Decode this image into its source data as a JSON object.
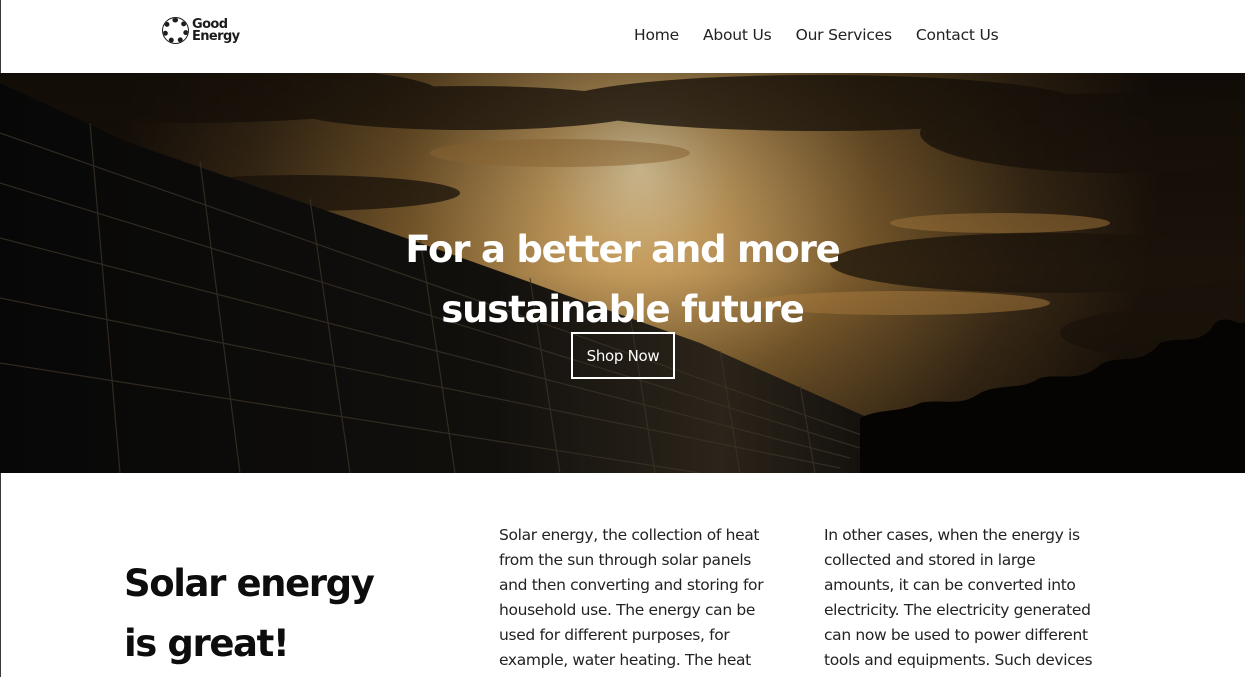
{
  "brand": {
    "logo_line1": "Good",
    "logo_line2": "Energy"
  },
  "nav": {
    "items": [
      {
        "label": "Home"
      },
      {
        "label": "About Us"
      },
      {
        "label": "Our Services"
      },
      {
        "label": "Contact Us"
      }
    ]
  },
  "hero": {
    "title_line1": "For a better and more",
    "title_line2": "sustainable future",
    "cta_label": "Shop Now"
  },
  "intro": {
    "headline_line1": "Solar energy",
    "headline_line2": "is great!",
    "column1_lines": [
      "Solar energy, the collection of heat",
      "from the sun through solar panels",
      "and then converting and storing for",
      "household use. The energy can be",
      "used for different purposes, for",
      "example, water heating. The heat"
    ],
    "column2_lines": [
      "In other cases, when the energy is",
      "collected and stored in large",
      "amounts, it can be converted into",
      "electricity. The electricity generated",
      "can now be used to power different",
      "tools and equipments. Such devices"
    ]
  },
  "colors": {
    "hero_sky_light": "#c9a060",
    "hero_sky_dark": "#2a1e10",
    "hero_panels": "#0b0a09",
    "text_dark": "#111111"
  }
}
